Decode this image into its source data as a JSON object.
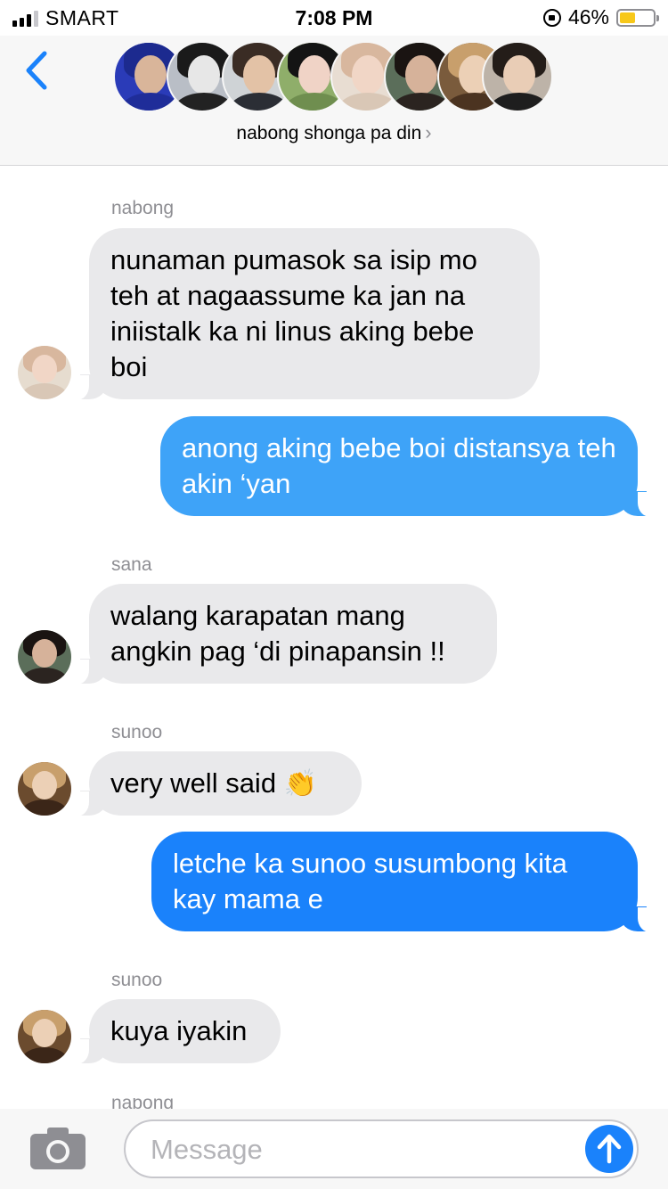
{
  "status_bar": {
    "carrier": "SMART",
    "time": "7:08 PM",
    "battery_percent": "46%",
    "battery_level": 0.46,
    "battery_color": "#f7c81a"
  },
  "header": {
    "group_name": "nabong shonga pa din",
    "chevron": "›",
    "back_icon": "chevron-left-icon",
    "accent_color": "#1a82fb"
  },
  "messages": [
    {
      "direction": "incoming",
      "sender": "nabong",
      "text": "nunaman pumasok sa isip mo teh at nagaassume ka jan na iniistalk ka ni linus aking bebe boi"
    },
    {
      "direction": "outgoing",
      "text": "anong aking bebe boi distansya teh akin ‘yan",
      "bubble_color": "#3ea3f8"
    },
    {
      "direction": "incoming",
      "sender": "sana",
      "text": "walang karapatan mang angkin pag ‘di pinapansin !!"
    },
    {
      "direction": "incoming",
      "sender": "sunoo",
      "text": "very well said",
      "emoji": "👏"
    },
    {
      "direction": "outgoing",
      "text": "letche ka sunoo susumbong kita kay mama e",
      "bubble_color": "#1a82fb"
    },
    {
      "direction": "incoming",
      "sender": "sunoo",
      "text": "kuya iyakin"
    }
  ],
  "next_sender_peek": "nabong",
  "input_bar": {
    "placeholder": "Message",
    "camera_icon": "camera-icon",
    "send_icon": "arrow-up-icon"
  }
}
